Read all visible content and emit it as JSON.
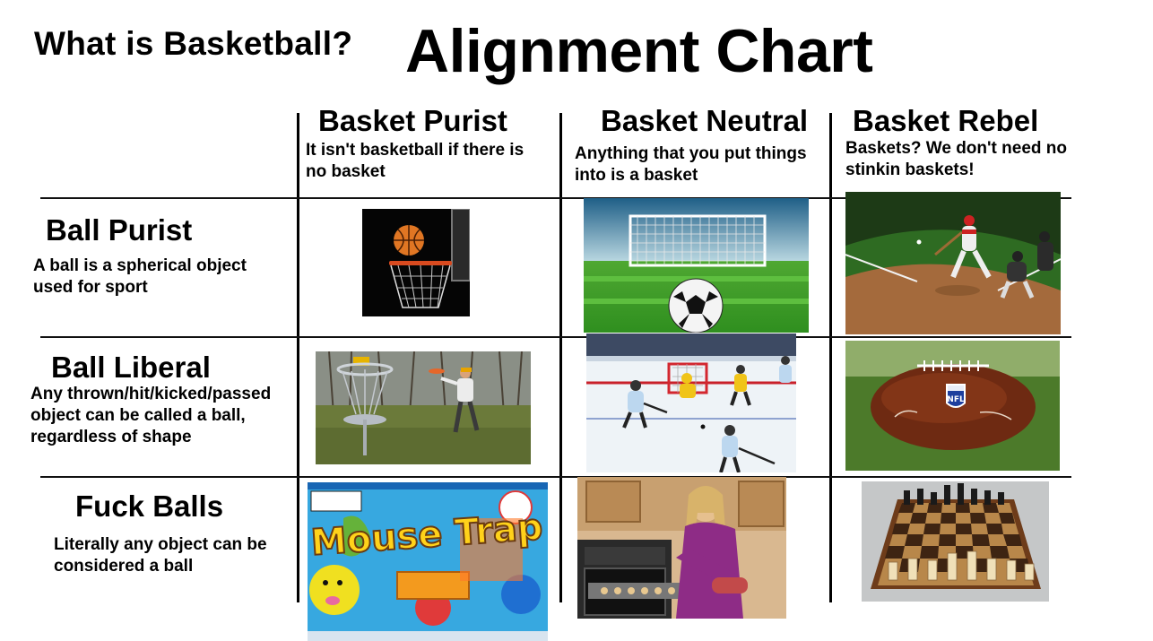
{
  "header": {
    "question": "What is Basketball?",
    "title": "Alignment Chart"
  },
  "columns": [
    {
      "name": "Basket Purist",
      "desc_line1": "It isn't basketball if there is",
      "desc_line2": "no basket"
    },
    {
      "name": "Basket Neutral",
      "desc_line1": "Anything that you put things",
      "desc_line2": "into is a basket"
    },
    {
      "name": "Basket Rebel",
      "desc_line1": "Baskets? We don't need no",
      "desc_line2": "stinkin baskets!"
    }
  ],
  "rows": [
    {
      "name": "Ball Purist",
      "desc_line1": "A ball is a spherical object",
      "desc_line2": "used for sport",
      "desc_line3": ""
    },
    {
      "name": "Ball Liberal",
      "desc_line1": "Any thrown/hit/kicked/passed",
      "desc_line2": "object can be called a ball,",
      "desc_line3": "regardless of shape"
    },
    {
      "name": "Fuck Balls",
      "desc_line1": "Literally any object can be",
      "desc_line2": "considered a ball",
      "desc_line3": ""
    }
  ],
  "images": {
    "game_box_logo": "Mouse Trap",
    "football_logo": "NFL"
  },
  "icons": [
    "basketball-hoop-icon",
    "soccer-goal-icon",
    "baseball-icon",
    "disc-golf-icon",
    "hockey-icon",
    "football-icon",
    "board-game-icon",
    "baking-icon",
    "chessboard-icon"
  ]
}
